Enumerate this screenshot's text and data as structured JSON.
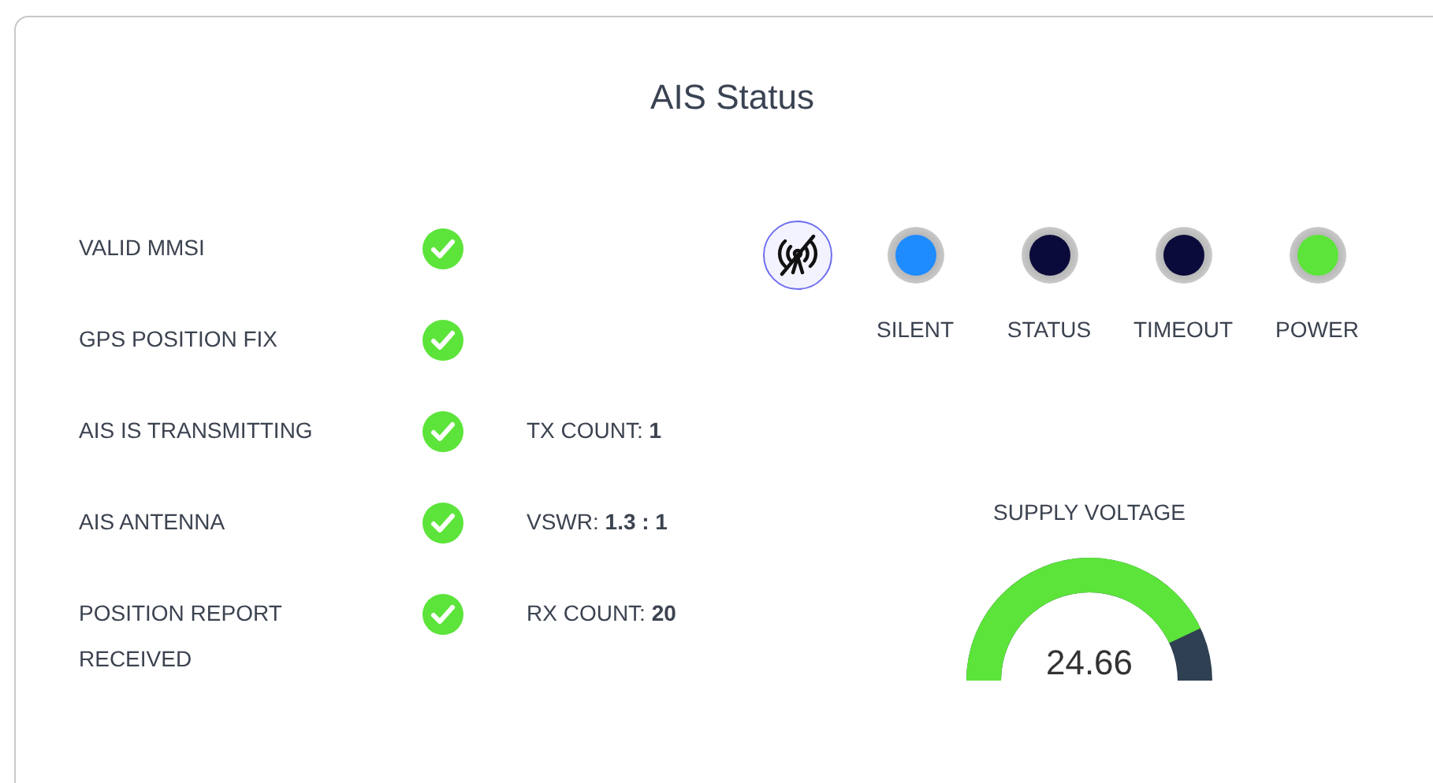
{
  "title": "AIS Status",
  "checks": [
    {
      "label": "VALID MMSI",
      "ok": true
    },
    {
      "label": "GPS POSITION FIX",
      "ok": true
    },
    {
      "label": "AIS IS TRANSMITTING",
      "ok": true,
      "info": "TX COUNT: **1**"
    },
    {
      "label": "AIS ANTENNA",
      "ok": true,
      "info": "VSWR: **1.3 : 1**"
    },
    {
      "label": "POSITION REPORT RECEIVED",
      "ok": true,
      "info": "RX COUNT: **20**"
    }
  ],
  "silent_button": {
    "selected": false
  },
  "leds": [
    {
      "label": "SILENT",
      "color": "#1e8bff"
    },
    {
      "label": "STATUS",
      "color": "#0b0b3b"
    },
    {
      "label": "TIMEOUT",
      "color": "#0b0b3b"
    },
    {
      "label": "POWER",
      "color": "#5ce43a"
    }
  ],
  "gauge": {
    "label": "SUPPLY VOLTAGE",
    "value": "24.66"
  }
}
